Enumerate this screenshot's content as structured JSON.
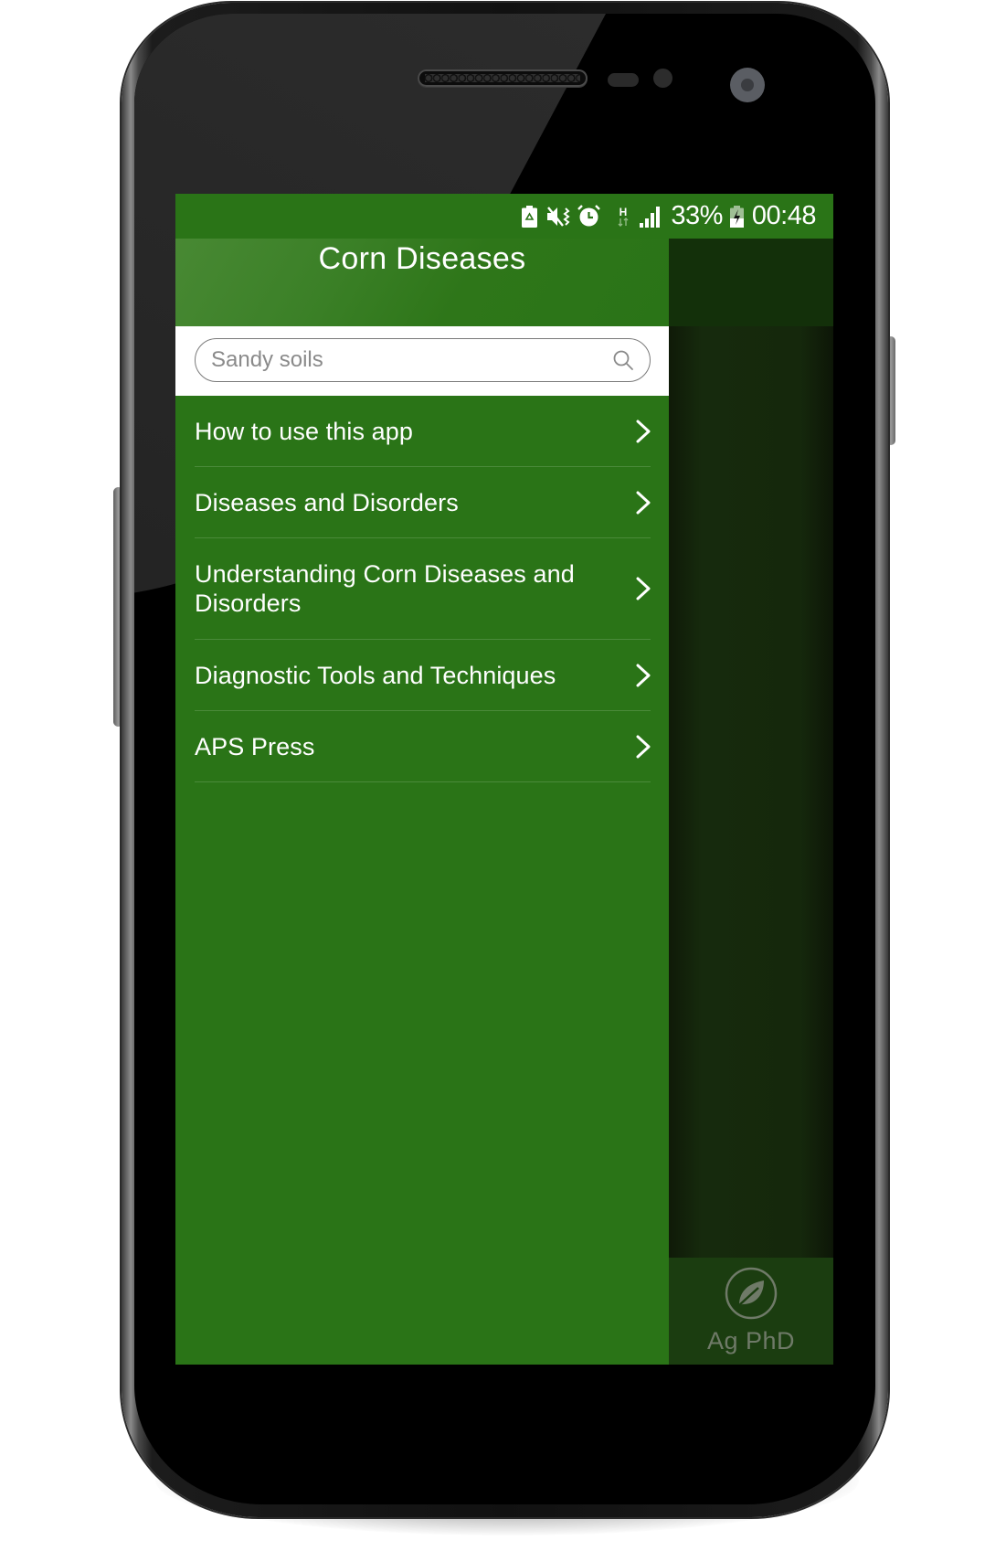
{
  "status_bar": {
    "icons": [
      "battery-saver-icon",
      "vibrate-mute-icon",
      "alarm-icon",
      "network-h-data-icon",
      "signal-icon",
      "battery-charging-icon"
    ],
    "battery_percent": "33%",
    "time": "00:48"
  },
  "drawer": {
    "title": "Corn Diseases",
    "search": {
      "value": "",
      "placeholder": "Sandy soils",
      "icon": "search-icon"
    },
    "items": [
      {
        "label": "How to use this app",
        "icon": "chevron-right-icon"
      },
      {
        "label": "Diseases and Disorders",
        "icon": "chevron-right-icon"
      },
      {
        "label": "Understanding Corn Diseases and Disorders",
        "icon": "chevron-right-icon"
      },
      {
        "label": "Diagnostic Tools and Techniques",
        "icon": "chevron-right-icon"
      },
      {
        "label": "APS Press",
        "icon": "chevron-right-icon"
      }
    ]
  },
  "background_app": {
    "footer_logo": "leaf-icon",
    "footer_label": "Ag PhD"
  },
  "colors": {
    "primary_green": "#2a7417",
    "header_green_light": "#4a8a35",
    "scrim_dark": "#141a0c",
    "footer_green": "#1b3d10"
  }
}
